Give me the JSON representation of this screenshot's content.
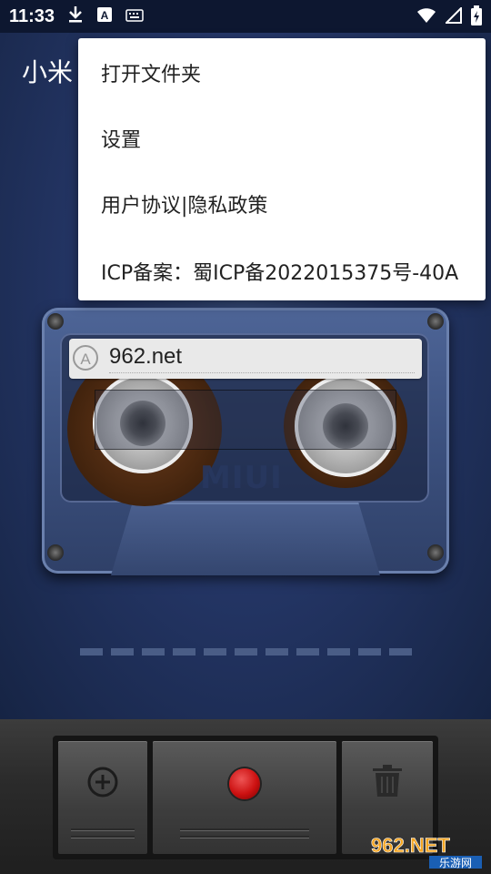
{
  "status_bar": {
    "time": "11:33"
  },
  "app": {
    "title": "小米"
  },
  "menu": {
    "items": [
      {
        "label": "打开文件夹"
      },
      {
        "label": "设置"
      },
      {
        "label": "用户协议|隐私政策"
      },
      {
        "label": "ICP备案：蜀ICP备2022015375号-40A"
      }
    ]
  },
  "cassette": {
    "label_badge": "A",
    "label_text": "962.net",
    "brand": "MIUI"
  },
  "watermark": {
    "text_main": "962.NET",
    "text_sub": "乐游网"
  },
  "colors": {
    "accent_record": "#cc1111",
    "menu_bg": "#ffffff"
  }
}
